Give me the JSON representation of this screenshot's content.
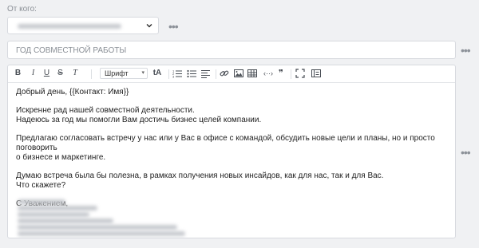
{
  "from": {
    "label": "От кого:"
  },
  "subject": {
    "value": "ГОД СОВМЕСТНОЙ РАБОТЫ"
  },
  "toolbar": {
    "bold": "B",
    "italic": "I",
    "underline": "U",
    "strike": "S",
    "clear": "T",
    "font_label": "Шрифт",
    "font_arrow": "▾",
    "size": "tA",
    "quote": "❞",
    "code": "‹··›"
  },
  "more": "•••",
  "email": {
    "greeting": "Добрый день, {{Контакт: Имя}}",
    "p1_l1": "Искренне рад нашей совместной деятельности.",
    "p1_l2": "Надеюсь за год мы помогли Вам достичь бизнес целей компании.",
    "p2_l1": "Предлагаю согласовать встречу у нас или у Вас в офисе с командой, обсудить новые цели и планы, но и просто поговорить",
    "p2_l2": "о бизнесе и маркетинге.",
    "p3_l1": "Думаю встреча была бы полезна, в рамках получения новых инсайдов, как для нас, так и для Вас.",
    "p3_l2": "Что скажете?",
    "closing": "С Уважением,"
  }
}
